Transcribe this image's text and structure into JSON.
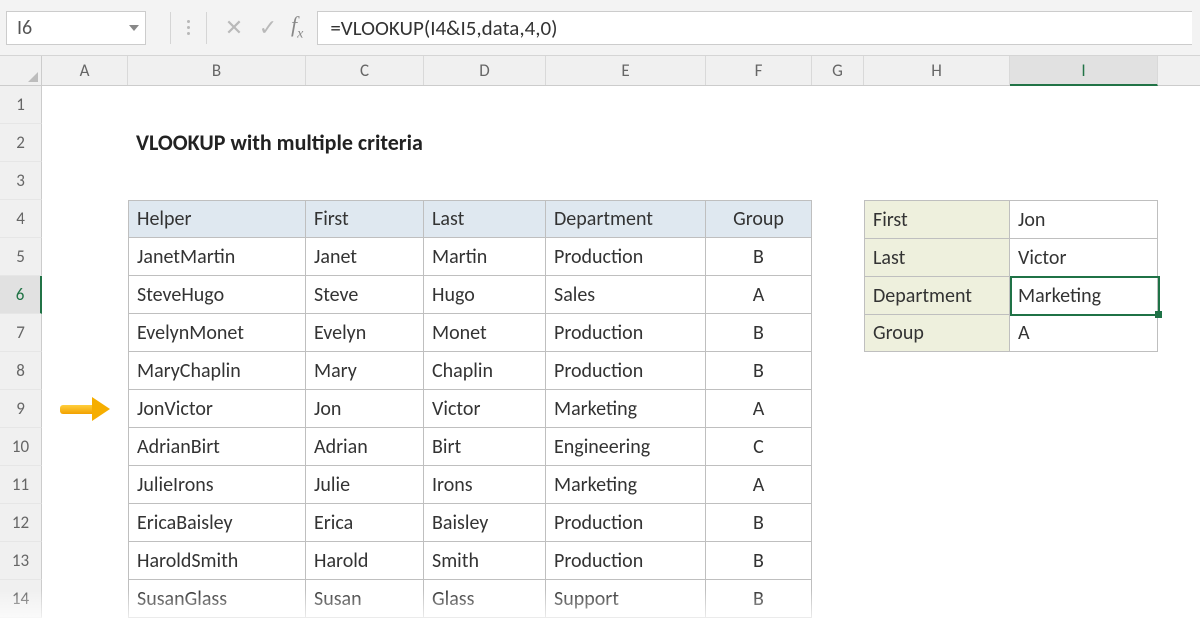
{
  "activeCellRef": "I6",
  "formula": "=VLOOKUP(I4&I5,data,4,0)",
  "columns": [
    "A",
    "B",
    "C",
    "D",
    "E",
    "F",
    "G",
    "H",
    "I"
  ],
  "rowNumbers": [
    "1",
    "2",
    "3",
    "4",
    "5",
    "6",
    "7",
    "8",
    "9",
    "10",
    "11",
    "12",
    "13",
    "14"
  ],
  "title": "VLOOKUP with multiple criteria",
  "table": {
    "headers": [
      "Helper",
      "First",
      "Last",
      "Department",
      "Group"
    ],
    "rows": [
      [
        "JanetMartin",
        "Janet",
        "Martin",
        "Production",
        "B"
      ],
      [
        "SteveHugo",
        "Steve",
        "Hugo",
        "Sales",
        "A"
      ],
      [
        "EvelynMonet",
        "Evelyn",
        "Monet",
        "Production",
        "B"
      ],
      [
        "MaryChaplin",
        "Mary",
        "Chaplin",
        "Production",
        "B"
      ],
      [
        "JonVictor",
        "Jon",
        "Victor",
        "Marketing",
        "A"
      ],
      [
        "AdrianBirt",
        "Adrian",
        "Birt",
        "Engineering",
        "C"
      ],
      [
        "JulieIrons",
        "Julie",
        "Irons",
        "Marketing",
        "A"
      ],
      [
        "EricaBaisley",
        "Erica",
        "Baisley",
        "Production",
        "B"
      ],
      [
        "HaroldSmith",
        "Harold",
        "Smith",
        "Production",
        "B"
      ],
      [
        "SusanGlass",
        "Susan",
        "Glass",
        "Support",
        "B"
      ]
    ]
  },
  "lookup": [
    {
      "label": "First",
      "value": "Jon"
    },
    {
      "label": "Last",
      "value": "Victor"
    },
    {
      "label": "Department",
      "value": "Marketing"
    },
    {
      "label": "Group",
      "value": "A"
    }
  ],
  "highlightRowIndex": 4,
  "colors": {
    "excelGreen": "#1f7246"
  }
}
